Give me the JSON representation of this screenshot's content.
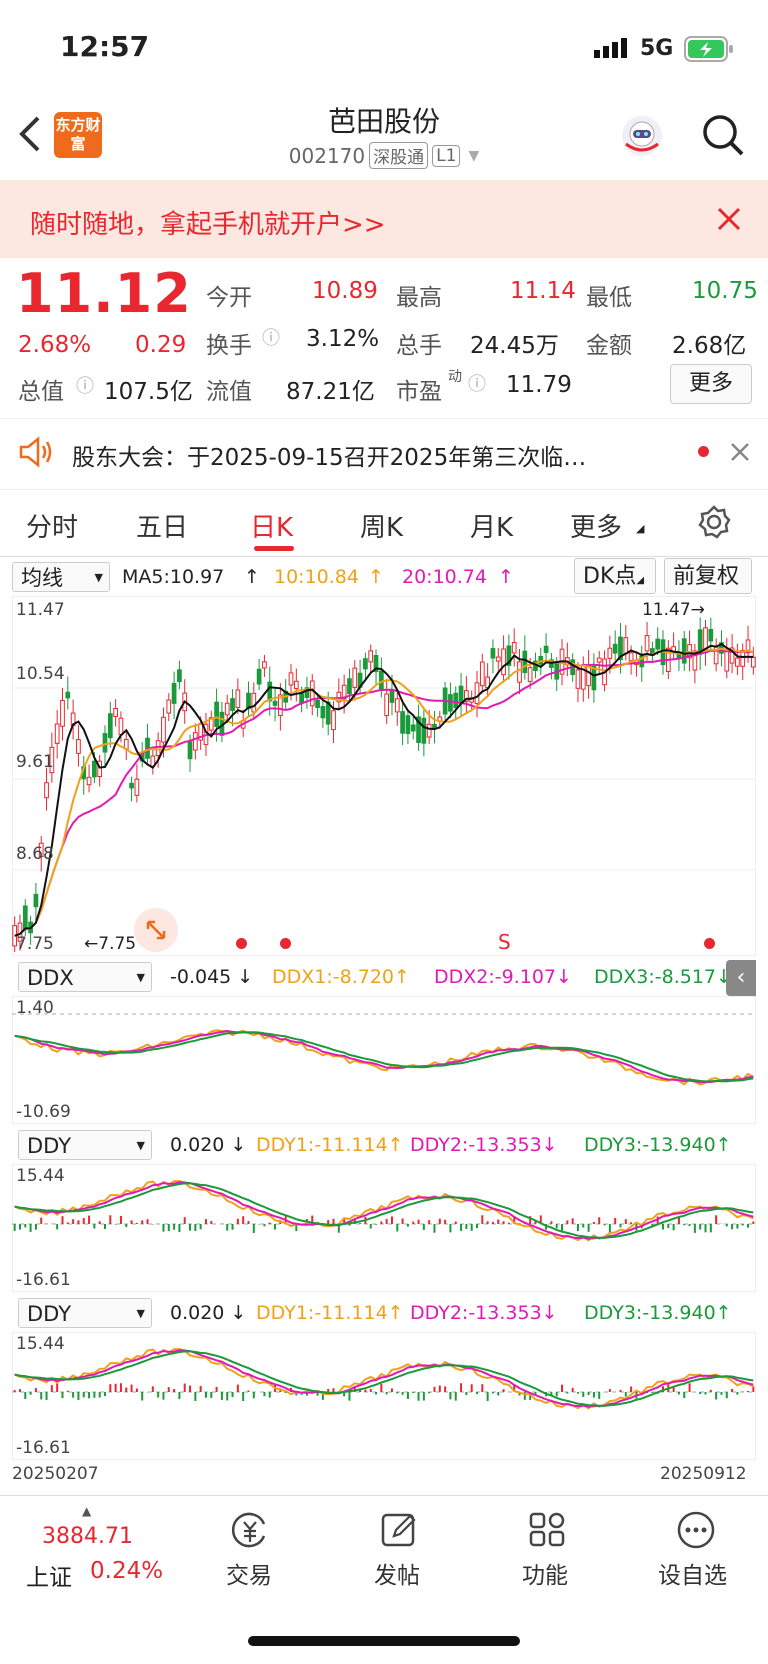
{
  "status_bar": {
    "time": "12:57",
    "network": "5G"
  },
  "header": {
    "title": "芭田股份",
    "code": "002170",
    "tag1": "深股通",
    "tag2": "L1",
    "logo": "东方财富"
  },
  "banner": {
    "text": "随时随地，拿起手机就开户>>"
  },
  "quote": {
    "price": "11.12",
    "change_pct": "2.68%",
    "change": "0.29",
    "open_label": "今开",
    "open": "10.89",
    "high_label": "最高",
    "high": "11.14",
    "low_label": "最低",
    "low": "10.75",
    "turnover_label": "换手",
    "turnover": "3.12%",
    "volume_label": "总手",
    "volume": "24.45万",
    "amount_label": "金额",
    "amount": "2.68亿",
    "mktcap_label": "总值",
    "mktcap": "107.5亿",
    "float_label": "流值",
    "float": "87.21亿",
    "pe_label": "市盈",
    "pe_sup": "动",
    "pe": "11.79",
    "more": "更多"
  },
  "notice": {
    "text": "股东大会：于2025-09-15召开2025年第三次临…"
  },
  "tabs": [
    "分时",
    "五日",
    "日K",
    "周K",
    "月K",
    "更多"
  ],
  "active_tab": "日K",
  "ma_bar": {
    "select": "均线",
    "ma5": "MA5:10.97",
    "ma10": "10:10.84",
    "ma20": "20:10.74",
    "dk": "DK点",
    "fq": "前复权"
  },
  "kline": {
    "y_labels": [
      "11.47",
      "10.54",
      "9.61",
      "8.68",
      "7.75"
    ],
    "high_note": "11.47",
    "low_note": "7.75",
    "s_mark": "S"
  },
  "ddx": {
    "select": "DDX",
    "value": "-0.045",
    "ddx1": "DDX1:-8.720",
    "ddx2": "DDX2:-9.107",
    "ddx3": "DDX3:-8.517",
    "y_top": "1.40",
    "y_bottom": "-10.69"
  },
  "ddy1": {
    "select": "DDY",
    "value": "0.020",
    "ddy1": "DDY1:-11.114",
    "ddy2": "DDY2:-13.353",
    "ddy3": "DDY3:-13.940",
    "y_top": "15.44",
    "y_bottom": "-16.61"
  },
  "ddy2": {
    "select": "DDY",
    "value": "0.020",
    "ddy1": "DDY1:-11.114",
    "ddy2": "DDY2:-13.353",
    "ddy3": "DDY3:-13.940",
    "y_top": "15.44",
    "y_bottom": "-16.61"
  },
  "dates": {
    "start": "20250207",
    "end": "20250912"
  },
  "index": {
    "value": "3884.71",
    "name": "上证",
    "pct": "0.24%"
  },
  "nav": [
    "交易",
    "发帖",
    "功能",
    "设自选"
  ],
  "colors": {
    "up": "#e8272f",
    "down": "#1a9a3a",
    "ma10": "#f0a11a",
    "ma20": "#e21ab4"
  }
}
